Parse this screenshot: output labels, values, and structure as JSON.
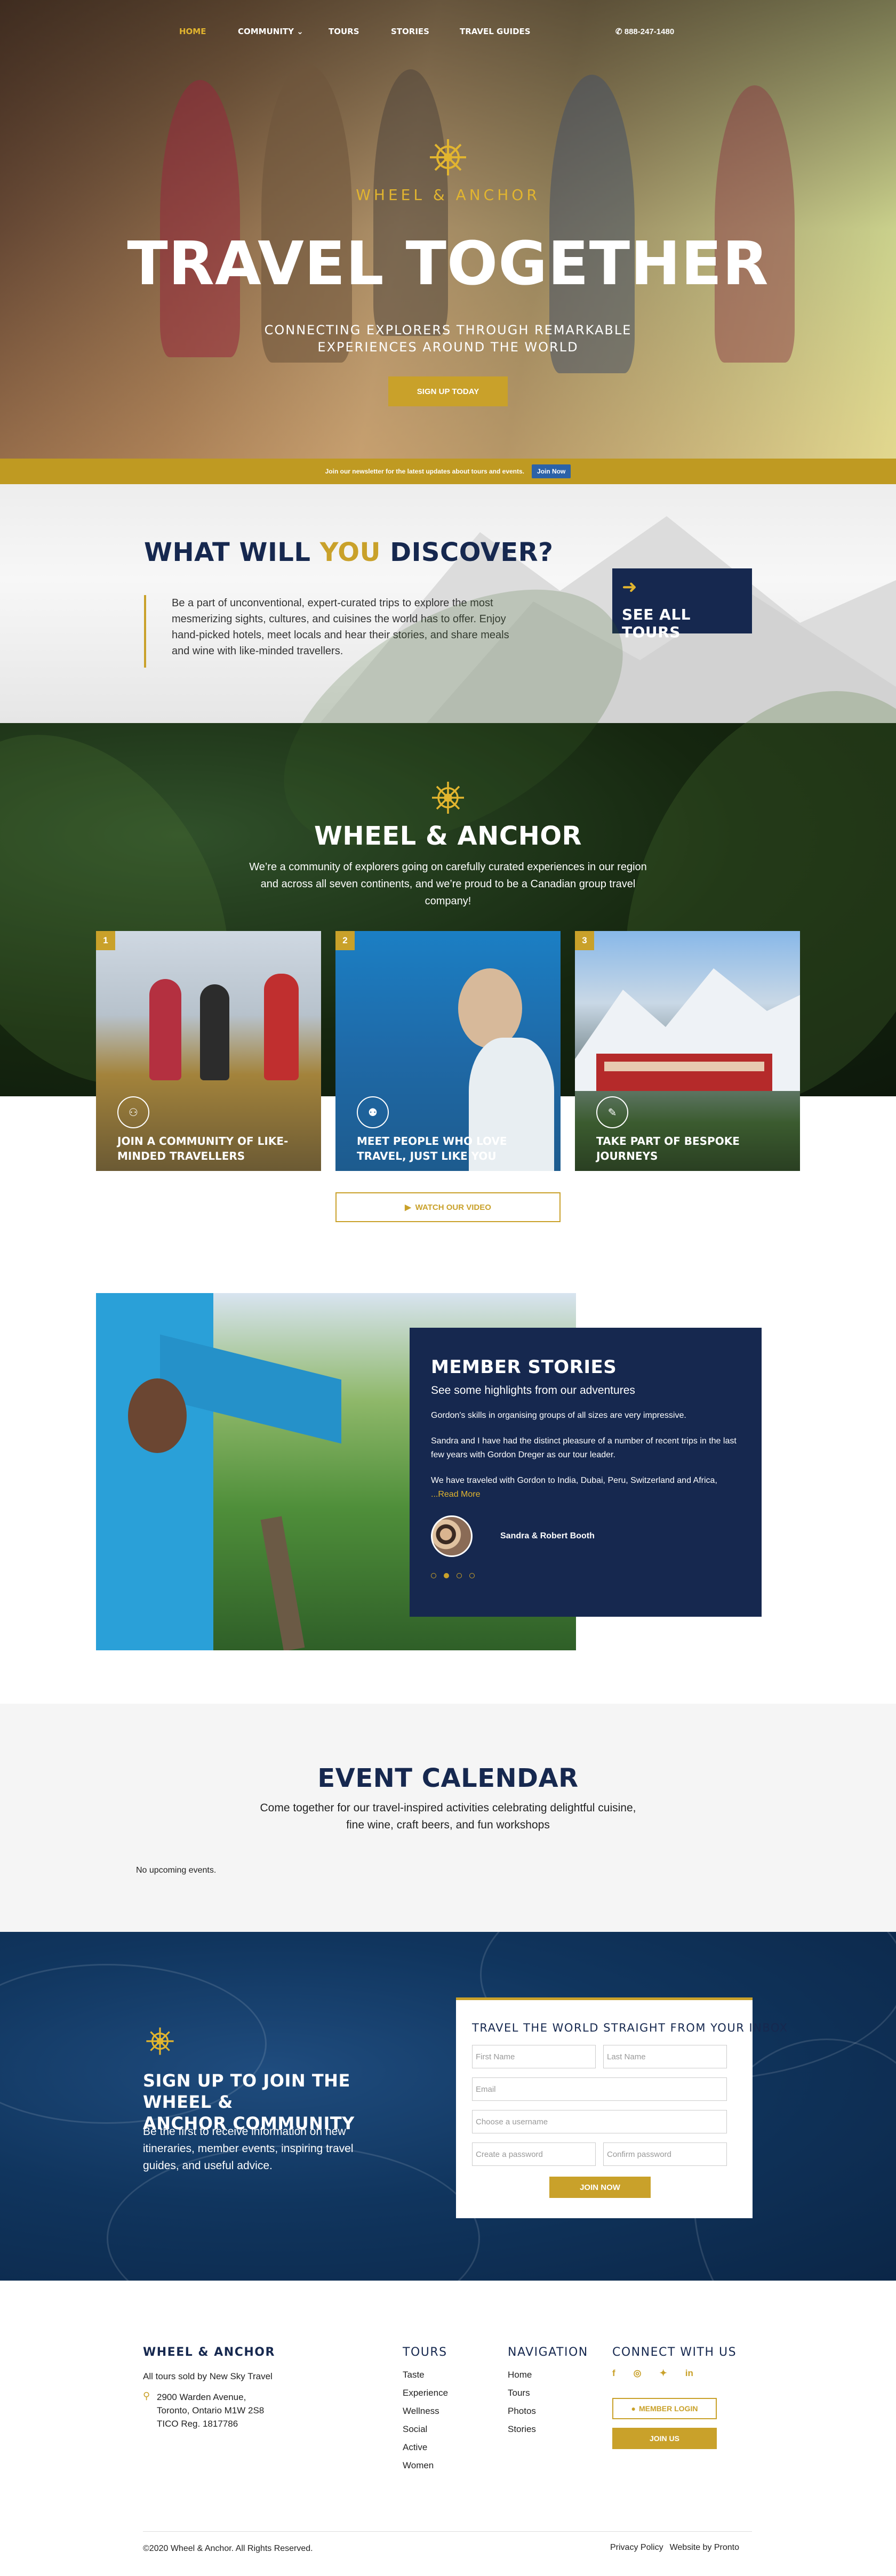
{
  "nav": {
    "items": [
      "HOME",
      "COMMUNITY",
      "TOURS",
      "STORIES",
      "TRAVEL GUIDES"
    ],
    "community_caret": "⌄",
    "phone": "888-247-1480"
  },
  "hero": {
    "logo_text": "WHEEL & ANCHOR",
    "title": "TRAVEL TOGETHER",
    "subtitle_line1": "CONNECTING EXPLORERS THROUGH REMARKABLE",
    "subtitle_line2": "EXPERIENCES AROUND THE WORLD",
    "cta": "SIGN UP TODAY"
  },
  "newsletter": {
    "text": "Join our newsletter for the latest updates about tours and events.",
    "button": "Join Now"
  },
  "discover": {
    "title_part1": "WHAT WILL ",
    "title_highlight": "YOU",
    "title_part2": " DISCOVER?",
    "body": "Be a part of unconventional, expert-curated trips to explore the most mesmerizing sights, cultures, and cuisines the world has to offer. Enjoy hand-picked hotels, meet locals and hear their stories, and share meals and wine with like-minded travellers.",
    "see_all": "SEE ALL TOURS"
  },
  "brand": {
    "title": "WHEEL & ANCHOR",
    "body": "We’re a community of explorers going on carefully curated experiences in our region and across all seven continents, and we’re proud to be a Canadian group travel company!",
    "cards": [
      {
        "num": "1",
        "label": "JOIN A COMMUNITY OF LIKE-MINDED TRAVELLERS",
        "icon": "people-icon"
      },
      {
        "num": "2",
        "label": "MEET PEOPLE WHO LOVE TRAVEL, JUST LIKE YOU",
        "icon": "group-icon"
      },
      {
        "num": "3",
        "label": "TAKE PART OF BESPOKE JOURNEYS",
        "icon": "compass-icon"
      }
    ],
    "watch_video": "WATCH OUR VIDEO"
  },
  "stories": {
    "title": "MEMBER STORIES",
    "subtitle": "See some highlights from our adventures",
    "p1": "Gordon's skills in organising groups of all sizes are very impressive.",
    "p2": "Sandra and I have had the distinct pleasure of a number of recent trips in the last few years with Gordon Dreger as our tour leader.",
    "p3": "We have traveled with Gordon to India, Dubai, Peru, Switzerland and Africa, ",
    "read_more": "...Read More",
    "author": "Sandra & Robert Booth",
    "active_dot": 1
  },
  "calendar": {
    "title": "EVENT CALENDAR",
    "line1": "Come together for our travel-inspired activities celebrating delightful cuisine,",
    "line2": "fine wine, craft beers, and fun workshops",
    "empty": "No upcoming events."
  },
  "signup": {
    "title_line1": "SIGN UP TO JOIN THE WHEEL &",
    "title_line2": "ANCHOR COMMUNITY",
    "body": "Be the first to receive information on new itineraries, member events, inspiring travel guides, and useful advice.",
    "form_title": "TRAVEL THE WORLD STRAIGHT FROM YOUR INBOX",
    "first_name": "First Name",
    "last_name": "Last Name",
    "email": "Email",
    "username": "Choose a username",
    "password": "Create a password",
    "confirm": "Confirm password",
    "button": "JOIN NOW"
  },
  "footer": {
    "brand": "WHEEL & ANCHOR",
    "sold_by": "All tours sold by New Sky Travel",
    "addr1": "2900 Warden Avenue,",
    "addr2": "Toronto, Ontario M1W 2S8",
    "tico": "TICO Reg. 1817786",
    "tours_title": "TOURS",
    "tours": [
      "Taste",
      "Experience",
      "Wellness",
      "Social",
      "Active",
      "Women"
    ],
    "nav_title": "NAVIGATION",
    "nav": [
      "Home",
      "Tours",
      "Photos",
      "Stories"
    ],
    "connect_title": "CONNECT WITH US",
    "member_login": "MEMBER LOGIN",
    "join_us": "JOIN US",
    "copyright": "©2020 Wheel & Anchor. All Rights Reserved.",
    "privacy": "Privacy Policy",
    "credit": "Website by Pronto"
  },
  "colors": {
    "gold": "#c9a12a",
    "navy": "#16284f",
    "blue": "#2b62a8"
  }
}
